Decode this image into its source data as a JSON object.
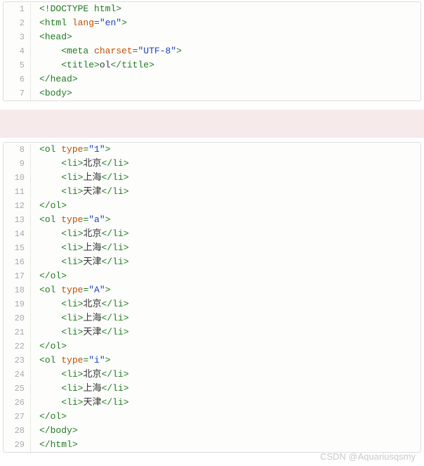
{
  "watermark": "CSDN @Aquariusqsmy",
  "blocks": [
    {
      "lines": [
        {
          "n": 1,
          "tokens": [
            [
              "<!",
              "punc"
            ],
            [
              "DOCTYPE html",
              "tag"
            ],
            [
              ">",
              "punc"
            ]
          ]
        },
        {
          "n": 2,
          "tokens": [
            [
              "<",
              "punc"
            ],
            [
              "html ",
              "tag"
            ],
            [
              "lang",
              "attr"
            ],
            [
              "=",
              "tag"
            ],
            [
              "\"en\"",
              "str"
            ],
            [
              ">",
              "punc"
            ]
          ]
        },
        {
          "n": 3,
          "tokens": [
            [
              "<",
              "punc"
            ],
            [
              "head",
              "tag"
            ],
            [
              ">",
              "punc"
            ]
          ]
        },
        {
          "n": 4,
          "indent": 1,
          "tokens": [
            [
              "<",
              "punc"
            ],
            [
              "meta ",
              "tag"
            ],
            [
              "charset",
              "attr"
            ],
            [
              "=",
              "tag"
            ],
            [
              "\"UTF-8\"",
              "str"
            ],
            [
              ">",
              "punc"
            ]
          ]
        },
        {
          "n": 5,
          "indent": 1,
          "tokens": [
            [
              "<",
              "punc"
            ],
            [
              "title",
              "tag"
            ],
            [
              ">",
              "punc"
            ],
            [
              "ol",
              "text"
            ],
            [
              "</",
              "punc"
            ],
            [
              "title",
              "tag"
            ],
            [
              ">",
              "punc"
            ]
          ]
        },
        {
          "n": 6,
          "tokens": [
            [
              "</",
              "punc"
            ],
            [
              "head",
              "tag"
            ],
            [
              ">",
              "punc"
            ]
          ]
        },
        {
          "n": 7,
          "tokens": [
            [
              "<",
              "punc"
            ],
            [
              "body",
              "tag"
            ],
            [
              ">",
              "punc"
            ]
          ]
        }
      ]
    },
    {
      "lines": [
        {
          "n": 8,
          "tokens": [
            [
              "<",
              "punc"
            ],
            [
              "ol ",
              "tag"
            ],
            [
              "type",
              "attr"
            ],
            [
              "=",
              "tag"
            ],
            [
              "\"1\"",
              "str"
            ],
            [
              ">",
              "punc"
            ]
          ]
        },
        {
          "n": 9,
          "indent": 1,
          "tokens": [
            [
              "<",
              "punc"
            ],
            [
              "li",
              "tag"
            ],
            [
              ">",
              "punc"
            ],
            [
              "北京",
              "text"
            ],
            [
              "</",
              "punc"
            ],
            [
              "li",
              "tag"
            ],
            [
              ">",
              "punc"
            ]
          ]
        },
        {
          "n": 10,
          "indent": 1,
          "tokens": [
            [
              "<",
              "punc"
            ],
            [
              "li",
              "tag"
            ],
            [
              ">",
              "punc"
            ],
            [
              "上海",
              "text"
            ],
            [
              "</",
              "punc"
            ],
            [
              "li",
              "tag"
            ],
            [
              ">",
              "punc"
            ]
          ]
        },
        {
          "n": 11,
          "indent": 1,
          "tokens": [
            [
              "<",
              "punc"
            ],
            [
              "li",
              "tag"
            ],
            [
              ">",
              "punc"
            ],
            [
              "天津",
              "text"
            ],
            [
              "</",
              "punc"
            ],
            [
              "li",
              "tag"
            ],
            [
              ">",
              "punc"
            ]
          ]
        },
        {
          "n": 12,
          "tokens": [
            [
              "</",
              "punc"
            ],
            [
              "ol",
              "tag"
            ],
            [
              ">",
              "punc"
            ]
          ]
        },
        {
          "n": 13,
          "tokens": [
            [
              "<",
              "punc"
            ],
            [
              "ol ",
              "tag"
            ],
            [
              "type",
              "attr"
            ],
            [
              "=",
              "tag"
            ],
            [
              "\"a\"",
              "str"
            ],
            [
              ">",
              "punc"
            ]
          ]
        },
        {
          "n": 14,
          "indent": 1,
          "tokens": [
            [
              "<",
              "punc"
            ],
            [
              "li",
              "tag"
            ],
            [
              ">",
              "punc"
            ],
            [
              "北京",
              "text"
            ],
            [
              "</",
              "punc"
            ],
            [
              "li",
              "tag"
            ],
            [
              ">",
              "punc"
            ]
          ]
        },
        {
          "n": 15,
          "indent": 1,
          "tokens": [
            [
              "<",
              "punc"
            ],
            [
              "li",
              "tag"
            ],
            [
              ">",
              "punc"
            ],
            [
              "上海",
              "text"
            ],
            [
              "</",
              "punc"
            ],
            [
              "li",
              "tag"
            ],
            [
              ">",
              "punc"
            ]
          ]
        },
        {
          "n": 16,
          "indent": 1,
          "tokens": [
            [
              "<",
              "punc"
            ],
            [
              "li",
              "tag"
            ],
            [
              ">",
              "punc"
            ],
            [
              "天津",
              "text"
            ],
            [
              "</",
              "punc"
            ],
            [
              "li",
              "tag"
            ],
            [
              ">",
              "punc"
            ]
          ]
        },
        {
          "n": 17,
          "tokens": [
            [
              "</",
              "punc"
            ],
            [
              "ol",
              "tag"
            ],
            [
              ">",
              "punc"
            ]
          ]
        },
        {
          "n": 18,
          "tokens": [
            [
              "<",
              "punc"
            ],
            [
              "ol ",
              "tag"
            ],
            [
              "type",
              "attr"
            ],
            [
              "=",
              "tag"
            ],
            [
              "\"A\"",
              "str"
            ],
            [
              ">",
              "punc"
            ]
          ]
        },
        {
          "n": 19,
          "indent": 1,
          "tokens": [
            [
              "<",
              "punc"
            ],
            [
              "li",
              "tag"
            ],
            [
              ">",
              "punc"
            ],
            [
              "北京",
              "text"
            ],
            [
              "</",
              "punc"
            ],
            [
              "li",
              "tag"
            ],
            [
              ">",
              "punc"
            ]
          ]
        },
        {
          "n": 20,
          "indent": 1,
          "tokens": [
            [
              "<",
              "punc"
            ],
            [
              "li",
              "tag"
            ],
            [
              ">",
              "punc"
            ],
            [
              "上海",
              "text"
            ],
            [
              "</",
              "punc"
            ],
            [
              "li",
              "tag"
            ],
            [
              ">",
              "punc"
            ]
          ]
        },
        {
          "n": 21,
          "indent": 1,
          "tokens": [
            [
              "<",
              "punc"
            ],
            [
              "li",
              "tag"
            ],
            [
              ">",
              "punc"
            ],
            [
              "天津",
              "text"
            ],
            [
              "</",
              "punc"
            ],
            [
              "li",
              "tag"
            ],
            [
              ">",
              "punc"
            ]
          ]
        },
        {
          "n": 22,
          "tokens": [
            [
              "</",
              "punc"
            ],
            [
              "ol",
              "tag"
            ],
            [
              ">",
              "punc"
            ]
          ]
        },
        {
          "n": 23,
          "tokens": [
            [
              "<",
              "punc"
            ],
            [
              "ol ",
              "tag"
            ],
            [
              "type",
              "attr"
            ],
            [
              "=",
              "tag"
            ],
            [
              "\"i\"",
              "str"
            ],
            [
              ">",
              "punc"
            ]
          ]
        },
        {
          "n": 24,
          "indent": 1,
          "tokens": [
            [
              "<",
              "punc"
            ],
            [
              "li",
              "tag"
            ],
            [
              ">",
              "punc"
            ],
            [
              "北京",
              "text"
            ],
            [
              "</",
              "punc"
            ],
            [
              "li",
              "tag"
            ],
            [
              ">",
              "punc"
            ]
          ]
        },
        {
          "n": 25,
          "indent": 1,
          "tokens": [
            [
              "<",
              "punc"
            ],
            [
              "li",
              "tag"
            ],
            [
              ">",
              "punc"
            ],
            [
              "上海",
              "text"
            ],
            [
              "</",
              "punc"
            ],
            [
              "li",
              "tag"
            ],
            [
              ">",
              "punc"
            ]
          ]
        },
        {
          "n": 26,
          "indent": 1,
          "tokens": [
            [
              "<",
              "punc"
            ],
            [
              "li",
              "tag"
            ],
            [
              ">",
              "punc"
            ],
            [
              "天津",
              "text"
            ],
            [
              "</",
              "punc"
            ],
            [
              "li",
              "tag"
            ],
            [
              ">",
              "punc"
            ]
          ]
        },
        {
          "n": 27,
          "tokens": [
            [
              "</",
              "punc"
            ],
            [
              "ol",
              "tag"
            ],
            [
              ">",
              "punc"
            ]
          ]
        },
        {
          "n": 28,
          "tokens": [
            [
              "</",
              "punc"
            ],
            [
              "body",
              "tag"
            ],
            [
              ">",
              "punc"
            ]
          ]
        },
        {
          "n": 29,
          "tokens": [
            [
              "</",
              "punc"
            ],
            [
              "html",
              "tag"
            ],
            [
              ">",
              "punc"
            ]
          ]
        }
      ]
    }
  ]
}
